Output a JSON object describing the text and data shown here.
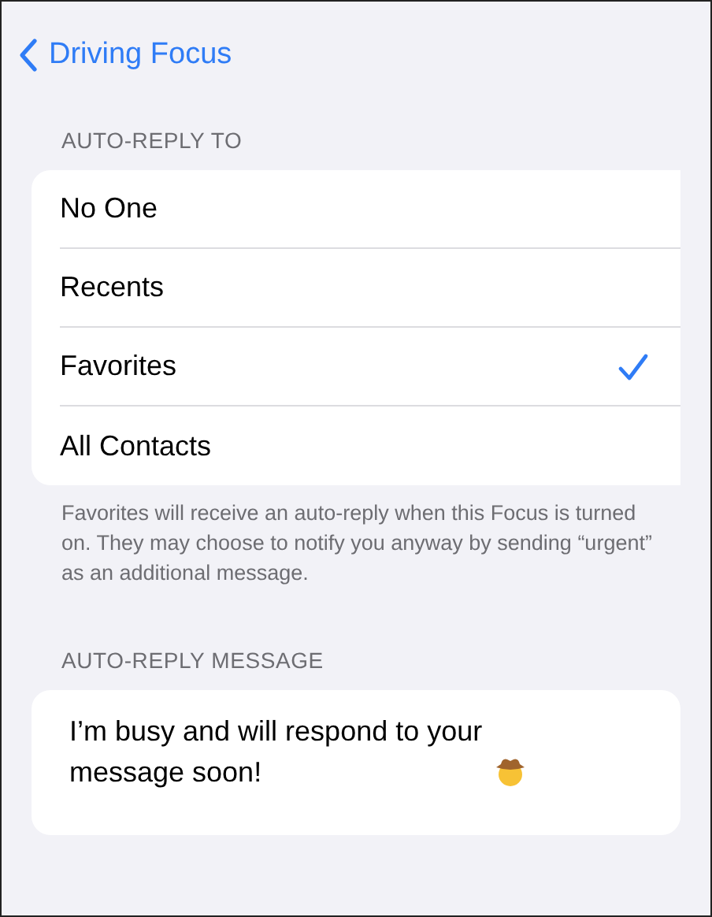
{
  "nav": {
    "back_label": "Driving Focus"
  },
  "auto_reply_to": {
    "header": "AUTO-REPLY TO",
    "options": [
      {
        "label": "No One",
        "selected": false
      },
      {
        "label": "Recents",
        "selected": false
      },
      {
        "label": "Favorites",
        "selected": true
      },
      {
        "label": "All Contacts",
        "selected": false
      }
    ],
    "footer": "Favorites will receive an auto-reply when this Focus is turned on. They may choose to notify you anyway by sending “urgent” as an additional message."
  },
  "auto_reply_message": {
    "header": "AUTO-REPLY MESSAGE",
    "value": "I’m busy and will respond to your message soon!"
  }
}
